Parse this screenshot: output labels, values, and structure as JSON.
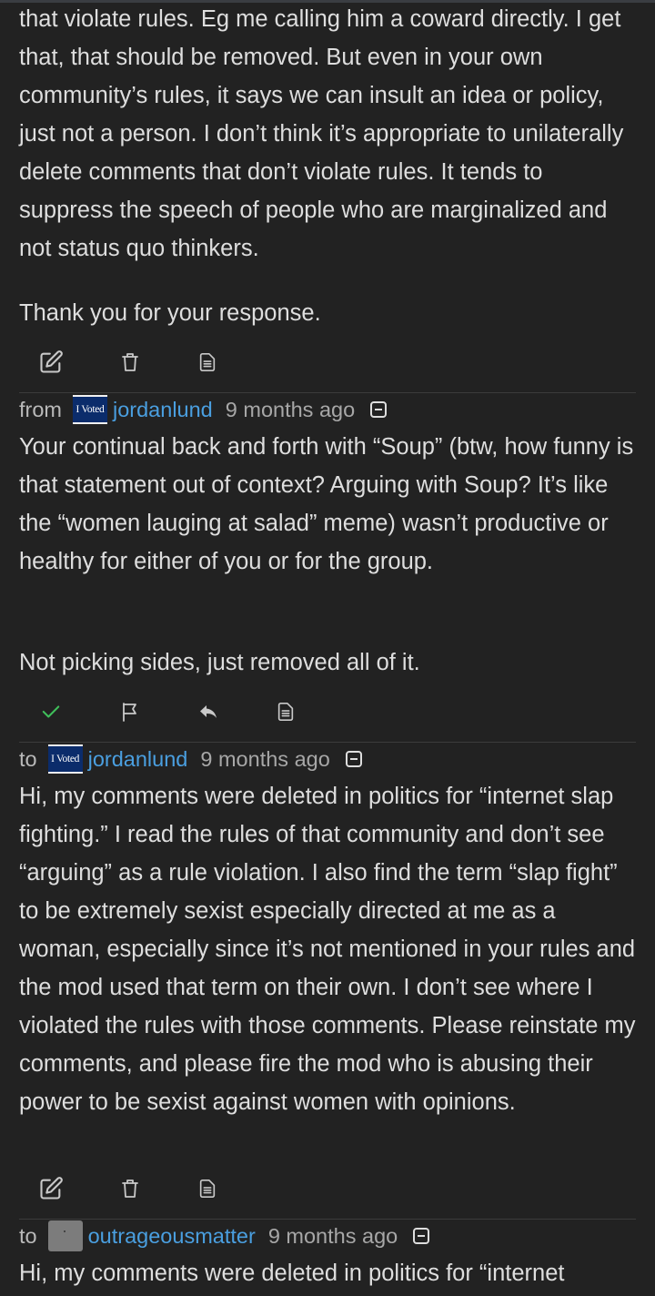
{
  "comments": [
    {
      "paragraphs": [
        "that violate rules. Eg me calling him a coward directly. I get that, that should be removed. But even in your own community’s rules, it says we can insult an idea or policy, just not a person. I don’t think it’s appropriate to unilaterally delete comments that don’t violate rules. It tends to suppress the speech of people who are marginalized and not status quo thinkers.",
        "Thank you for your response."
      ]
    },
    {
      "direction": "from",
      "avatar_text": "I Voted",
      "username": "jordanlund",
      "time": "9 months ago",
      "paragraphs": [
        "Your continual back and forth with “Soup” (btw, how funny is that statement out of context? Arguing with Soup? It’s like the “women lauging at salad” meme) wasn’t productive or healthy for either of you or for the group.",
        "Not picking sides, just removed all of it."
      ]
    },
    {
      "direction": "to",
      "avatar_text": "I Voted",
      "username": "jordanlund",
      "time": "9 months ago",
      "paragraphs": [
        "Hi, my comments were deleted in politics for “internet slap fighting.” I read the rules of that community and don’t see “arguing” as a rule violation. I also find the term “slap fight” to be extremely sexist especially directed at me as a woman, especially since it’s not mentioned in your rules and the mod used that term on their own. I don’t see where I violated the rules with those comments. Please reinstate my comments, and please fire the mod who is abusing their power to be sexist against women with opinions."
      ]
    },
    {
      "direction": "to",
      "username": "outrageousmatter",
      "time": "9 months ago",
      "paragraphs": [
        "Hi, my comments were deleted in politics for “internet"
      ]
    }
  ],
  "colors": {
    "background": "#222222",
    "text": "#dedede",
    "username": "#4a9fe0",
    "muted": "#a7a7a7",
    "check": "#3fbf5a"
  },
  "icons": {
    "sent_actions": [
      "edit-icon",
      "trash-icon",
      "source-icon"
    ],
    "received_actions": [
      "check-icon",
      "flag-icon",
      "reply-icon",
      "source-icon"
    ],
    "collapse": "minus-square-icon"
  }
}
